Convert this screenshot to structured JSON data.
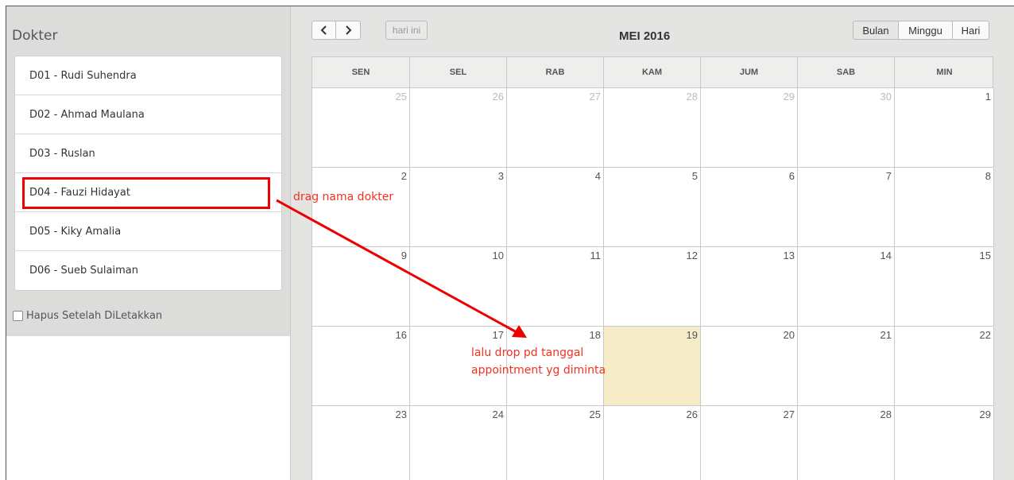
{
  "sidebar": {
    "title": "Dokter",
    "doctors": [
      {
        "label": "D01 - Rudi Suhendra"
      },
      {
        "label": "D02 - Ahmad Maulana"
      },
      {
        "label": "D03 - Ruslan"
      },
      {
        "label": "D04 - Fauzi Hidayat"
      },
      {
        "label": "D05 - Kiky Amalia"
      },
      {
        "label": "D06 - Sueb Sulaiman"
      }
    ],
    "delete_after_drop_label": "Hapus Setelah DiLetakkan"
  },
  "calendar": {
    "title": "MEI 2016",
    "today_button": "hari ini",
    "views": {
      "month": "Bulan",
      "week": "Minggu",
      "day": "Hari"
    },
    "weekdays": [
      "SEN",
      "SEL",
      "RAB",
      "KAM",
      "JUM",
      "SAB",
      "MIN"
    ],
    "weeks": [
      [
        "25",
        "26",
        "27",
        "28",
        "29",
        "30",
        "1"
      ],
      [
        "2",
        "3",
        "4",
        "5",
        "6",
        "7",
        "8"
      ],
      [
        "9",
        "10",
        "11",
        "12",
        "13",
        "14",
        "15"
      ],
      [
        "16",
        "17",
        "18",
        "19",
        "20",
        "21",
        "22"
      ],
      [
        "23",
        "24",
        "25",
        "26",
        "27",
        "28",
        "29"
      ]
    ]
  },
  "annotations": {
    "drag": "drag nama dokter",
    "drop_line1": "lalu drop pd tanggal",
    "drop_line2": "appointment yg diminta"
  },
  "colors": {
    "annotation": "#ee2200",
    "today_bg": "#f6ecc8"
  }
}
